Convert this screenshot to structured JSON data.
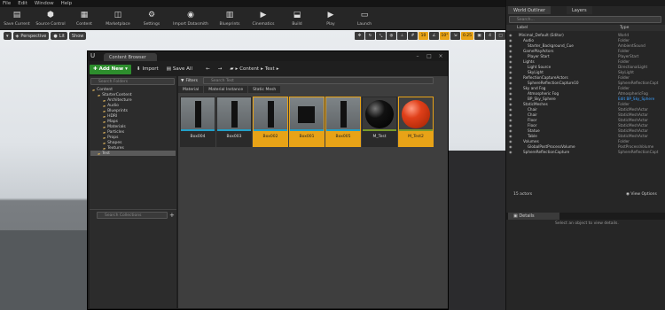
{
  "menu": [
    "File",
    "Edit",
    "Window",
    "Help"
  ],
  "toolbar": [
    {
      "label": "Save Current",
      "icon": "save-icon"
    },
    {
      "label": "Source Control",
      "icon": "source-control-icon"
    },
    {
      "label": "Content",
      "icon": "content-icon"
    },
    {
      "label": "Marketplace",
      "icon": "marketplace-icon"
    },
    {
      "label": "Settings",
      "icon": "settings-icon"
    },
    {
      "label": "Import Datasmith",
      "icon": "datasmith-icon"
    },
    {
      "label": "Blueprints",
      "icon": "blueprints-icon"
    },
    {
      "label": "Cinematics",
      "icon": "cinematics-icon"
    },
    {
      "label": "Build",
      "icon": "build-icon"
    },
    {
      "label": "Play",
      "icon": "play-icon"
    },
    {
      "label": "Launch",
      "icon": "launch-icon"
    }
  ],
  "viewport": {
    "perspective": "Perspective",
    "lit": "Lit",
    "show": "Show",
    "snap_grid": "10",
    "snap_rot": "10°",
    "snap_scale": "0.25",
    "cam_speed": "4"
  },
  "content_browser": {
    "tab_title": "Content Browser",
    "add_new": "Add New",
    "import": "Import",
    "save_all": "Save All",
    "breadcrumb": [
      "Content",
      "Test"
    ],
    "search_folders": "Search Folders",
    "filters": "Filters",
    "search_test": "Search Test",
    "search_collections": "Search Collections",
    "folders": [
      "Content",
      "StarterContent",
      "Architecture",
      "Audio",
      "Blueprints",
      "HDRI",
      "Maps",
      "Materials",
      "Particles",
      "Props",
      "Shapes",
      "Textures",
      "Test"
    ],
    "filter_tabs": [
      "Material",
      "Material Instance",
      "Static Mesh"
    ],
    "assets": [
      {
        "name": "Box004",
        "selected": false,
        "kind": "tall"
      },
      {
        "name": "Box003",
        "selected": false,
        "kind": "tall"
      },
      {
        "name": "Box002",
        "selected": true,
        "kind": "tall"
      },
      {
        "name": "Box001",
        "selected": true,
        "kind": "cube"
      },
      {
        "name": "Box005",
        "selected": true,
        "kind": "tall"
      },
      {
        "name": "M_Test",
        "selected": false,
        "kind": "black-sphere"
      },
      {
        "name": "M_Test2",
        "selected": true,
        "kind": "red-sphere"
      }
    ]
  },
  "outliner": {
    "tab_title": "World Outliner",
    "layers_tab": "Layers",
    "search_placeholder": "Search...",
    "col_label": "Label",
    "col_type": "Type",
    "rows": [
      {
        "label": "Minimal_Default (Editor)",
        "type": "World",
        "indent": 0
      },
      {
        "label": "Audio",
        "type": "Folder",
        "indent": 1
      },
      {
        "label": "Starter_Background_Cue",
        "type": "AmbientSound",
        "indent": 2
      },
      {
        "label": "GamePlayActors",
        "type": "Folder",
        "indent": 1
      },
      {
        "label": "Player Start",
        "type": "PlayerStart",
        "indent": 2
      },
      {
        "label": "Lights",
        "type": "Folder",
        "indent": 1
      },
      {
        "label": "Light Source",
        "type": "DirectionalLight",
        "indent": 2
      },
      {
        "label": "SkyLight",
        "type": "SkyLight",
        "indent": 2
      },
      {
        "label": "ReflectionCaptureActors",
        "type": "Folder",
        "indent": 1
      },
      {
        "label": "SphereReflectionCapture10",
        "type": "SphereReflectionCapt",
        "indent": 2
      },
      {
        "label": "Sky and Fog",
        "type": "Folder",
        "indent": 1
      },
      {
        "label": "Atmospheric Fog",
        "type": "AtmosphericFog",
        "indent": 2
      },
      {
        "label": "BP_Sky_Sphere",
        "type": "Edit BP_Sky_Sphere",
        "indent": 2
      },
      {
        "label": "StaticMeshes",
        "type": "Folder",
        "indent": 1
      },
      {
        "label": "Chair",
        "type": "StaticMeshActor",
        "indent": 2
      },
      {
        "label": "Chair",
        "type": "StaticMeshActor",
        "indent": 2
      },
      {
        "label": "Floor",
        "type": "StaticMeshActor",
        "indent": 2
      },
      {
        "label": "Floor",
        "type": "StaticMeshActor",
        "indent": 2
      },
      {
        "label": "Statue",
        "type": "StaticMeshActor",
        "indent": 2
      },
      {
        "label": "Table",
        "type": "StaticMeshActor",
        "indent": 2
      },
      {
        "label": "Volumes",
        "type": "Folder",
        "indent": 1
      },
      {
        "label": "GlobalPostProcessVolume",
        "type": "PostProcessVolume",
        "indent": 2
      },
      {
        "label": "SphereReflectionCapture",
        "type": "SphereReflectionCapt",
        "indent": 1
      }
    ],
    "actor_count": "15 actors",
    "view_options": "View Options"
  },
  "details": {
    "tab_title": "Details",
    "empty_msg": "Select an object to view details."
  },
  "colors": {
    "accent": "#e8a317",
    "add_green": "#2d8e2d",
    "link_blue": "#3aa0ff"
  }
}
